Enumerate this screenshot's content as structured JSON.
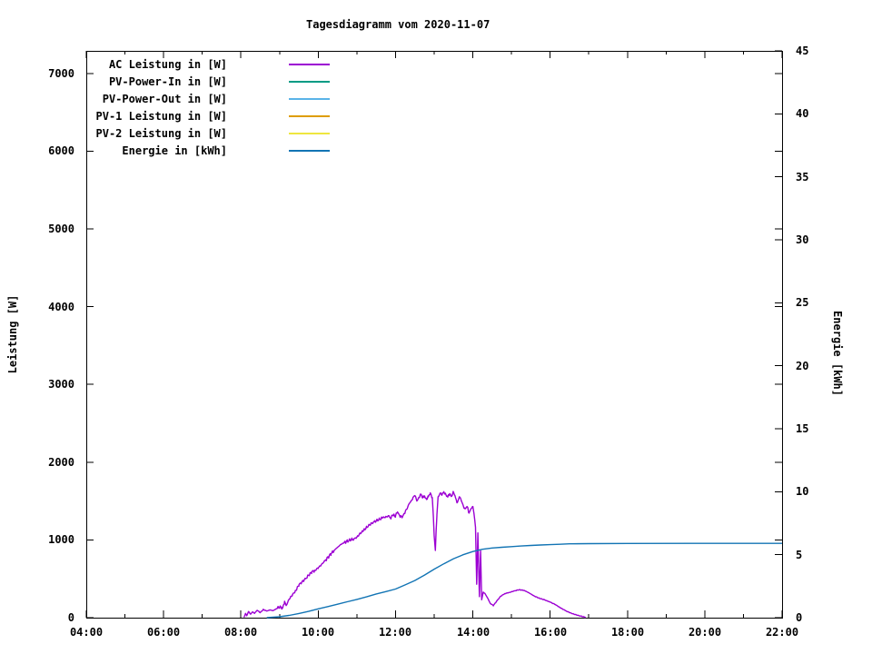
{
  "chart_data": {
    "type": "line",
    "title": "Tagesdiagramm vom 2020-11-07",
    "background": "#ffffff",
    "legend_position": "top-left-inside",
    "grid": false,
    "x_axis": {
      "label": "",
      "range_hours": [
        4,
        22
      ],
      "tick_hours": [
        4,
        6,
        8,
        10,
        12,
        14,
        16,
        18,
        20,
        22
      ],
      "tick_labels": [
        "04:00",
        "06:00",
        "08:00",
        "10:00",
        "12:00",
        "14:00",
        "16:00",
        "18:00",
        "20:00",
        "22:00"
      ],
      "minor_tick_hours": [
        5,
        7,
        9,
        11,
        13,
        15,
        17,
        19,
        21
      ]
    },
    "y_left": {
      "label": "Leistung [W]",
      "range": [
        0,
        7290
      ],
      "ticks": [
        0,
        1000,
        2000,
        3000,
        4000,
        5000,
        6000,
        7000
      ],
      "tick_labels": [
        "0",
        "1000",
        "2000",
        "3000",
        "4000",
        "5000",
        "6000",
        "7000"
      ]
    },
    "y_right": {
      "label": "Energie [kWh]",
      "range": [
        0,
        45
      ],
      "ticks": [
        0,
        5,
        10,
        15,
        20,
        25,
        30,
        35,
        40,
        45
      ],
      "tick_labels": [
        "0",
        "5",
        "10",
        "15",
        "20",
        "25",
        "30",
        "35",
        "40",
        "45"
      ]
    },
    "series": [
      {
        "name": "AC Leistung in [W]",
        "color": "#9C00D3",
        "axis": "left",
        "points": [
          [
            8.08,
            5
          ],
          [
            8.12,
            55
          ],
          [
            8.15,
            25
          ],
          [
            8.2,
            80
          ],
          [
            8.25,
            45
          ],
          [
            8.3,
            75
          ],
          [
            8.35,
            55
          ],
          [
            8.42,
            95
          ],
          [
            8.5,
            65
          ],
          [
            8.58,
            105
          ],
          [
            8.67,
            85
          ],
          [
            8.75,
            100
          ],
          [
            8.83,
            90
          ],
          [
            8.92,
            115
          ],
          [
            9.0,
            135
          ],
          [
            9.08,
            125
          ],
          [
            9.13,
            210
          ],
          [
            9.17,
            155
          ],
          [
            9.25,
            240
          ],
          [
            9.33,
            290
          ],
          [
            9.42,
            350
          ],
          [
            9.5,
            420
          ],
          [
            9.58,
            460
          ],
          [
            9.67,
            500
          ],
          [
            9.75,
            545
          ],
          [
            9.83,
            585
          ],
          [
            9.92,
            610
          ],
          [
            10.0,
            640
          ],
          [
            10.08,
            680
          ],
          [
            10.17,
            730
          ],
          [
            10.25,
            775
          ],
          [
            10.33,
            820
          ],
          [
            10.42,
            870
          ],
          [
            10.5,
            905
          ],
          [
            10.58,
            940
          ],
          [
            10.67,
            965
          ],
          [
            10.75,
            985
          ],
          [
            10.83,
            1000
          ],
          [
            10.92,
            1010
          ],
          [
            11.0,
            1035
          ],
          [
            11.08,
            1080
          ],
          [
            11.17,
            1120
          ],
          [
            11.25,
            1160
          ],
          [
            11.33,
            1195
          ],
          [
            11.42,
            1225
          ],
          [
            11.5,
            1245
          ],
          [
            11.58,
            1265
          ],
          [
            11.67,
            1285
          ],
          [
            11.75,
            1295
          ],
          [
            11.83,
            1310
          ],
          [
            11.88,
            1270
          ],
          [
            11.92,
            1320
          ],
          [
            12.0,
            1305
          ],
          [
            12.05,
            1360
          ],
          [
            12.1,
            1320
          ],
          [
            12.17,
            1285
          ],
          [
            12.22,
            1340
          ],
          [
            12.28,
            1395
          ],
          [
            12.33,
            1445
          ],
          [
            12.4,
            1500
          ],
          [
            12.45,
            1545
          ],
          [
            12.5,
            1570
          ],
          [
            12.55,
            1500
          ],
          [
            12.6,
            1545
          ],
          [
            12.65,
            1590
          ],
          [
            12.7,
            1540
          ],
          [
            12.75,
            1565
          ],
          [
            12.8,
            1520
          ],
          [
            12.85,
            1555
          ],
          [
            12.9,
            1605
          ],
          [
            12.95,
            1545
          ],
          [
            12.98,
            1300
          ],
          [
            13.0,
            1050
          ],
          [
            13.03,
            865
          ],
          [
            13.07,
            1320
          ],
          [
            13.1,
            1555
          ],
          [
            13.15,
            1600
          ],
          [
            13.2,
            1575
          ],
          [
            13.25,
            1620
          ],
          [
            13.3,
            1585
          ],
          [
            13.35,
            1550
          ],
          [
            13.4,
            1595
          ],
          [
            13.45,
            1560
          ],
          [
            13.5,
            1615
          ],
          [
            13.55,
            1545
          ],
          [
            13.6,
            1480
          ],
          [
            13.65,
            1555
          ],
          [
            13.7,
            1505
          ],
          [
            13.75,
            1445
          ],
          [
            13.8,
            1400
          ],
          [
            13.85,
            1430
          ],
          [
            13.9,
            1345
          ],
          [
            13.95,
            1400
          ],
          [
            14.0,
            1430
          ],
          [
            14.03,
            1340
          ],
          [
            14.07,
            1160
          ],
          [
            14.1,
            430
          ],
          [
            14.13,
            1090
          ],
          [
            14.17,
            270
          ],
          [
            14.2,
            860
          ],
          [
            14.23,
            230
          ],
          [
            14.27,
            330
          ],
          [
            14.32,
            305
          ],
          [
            14.38,
            255
          ],
          [
            14.45,
            185
          ],
          [
            14.53,
            155
          ],
          [
            14.62,
            215
          ],
          [
            14.72,
            275
          ],
          [
            14.83,
            310
          ],
          [
            14.95,
            325
          ],
          [
            15.08,
            345
          ],
          [
            15.2,
            360
          ],
          [
            15.33,
            350
          ],
          [
            15.45,
            320
          ],
          [
            15.58,
            280
          ],
          [
            15.72,
            250
          ],
          [
            15.85,
            230
          ],
          [
            16.0,
            200
          ],
          [
            16.13,
            170
          ],
          [
            16.27,
            125
          ],
          [
            16.42,
            85
          ],
          [
            16.58,
            50
          ],
          [
            16.75,
            25
          ],
          [
            16.92,
            5
          ]
        ]
      },
      {
        "name": "PV-Power-In in [W]",
        "color": "#009B84",
        "axis": "left",
        "points": []
      },
      {
        "name": "PV-Power-Out in [W]",
        "color": "#5AB3E8",
        "axis": "left",
        "points": []
      },
      {
        "name": "PV-1 Leistung in [W]",
        "color": "#DE9D00",
        "axis": "left",
        "points": []
      },
      {
        "name": "PV-2 Leistung in [W]",
        "color": "#EEE63F",
        "axis": "left",
        "points": []
      },
      {
        "name": "Energie in [kWh]",
        "color": "#1274B4",
        "axis": "right",
        "points": [
          [
            8.67,
            0
          ],
          [
            9.0,
            0.07
          ],
          [
            9.25,
            0.18
          ],
          [
            9.5,
            0.33
          ],
          [
            9.75,
            0.5
          ],
          [
            10.0,
            0.7
          ],
          [
            10.25,
            0.88
          ],
          [
            10.5,
            1.07
          ],
          [
            10.75,
            1.26
          ],
          [
            11.0,
            1.45
          ],
          [
            11.25,
            1.65
          ],
          [
            11.5,
            1.88
          ],
          [
            11.75,
            2.07
          ],
          [
            12.0,
            2.27
          ],
          [
            12.25,
            2.6
          ],
          [
            12.5,
            2.95
          ],
          [
            12.75,
            3.38
          ],
          [
            13.0,
            3.85
          ],
          [
            13.25,
            4.28
          ],
          [
            13.5,
            4.68
          ],
          [
            13.75,
            5.0
          ],
          [
            14.0,
            5.25
          ],
          [
            14.25,
            5.43
          ],
          [
            14.5,
            5.53
          ],
          [
            14.75,
            5.59
          ],
          [
            15.0,
            5.64
          ],
          [
            15.25,
            5.69
          ],
          [
            15.5,
            5.73
          ],
          [
            15.75,
            5.77
          ],
          [
            16.0,
            5.8
          ],
          [
            16.25,
            5.83
          ],
          [
            16.5,
            5.86
          ],
          [
            17.0,
            5.88
          ],
          [
            18.0,
            5.89
          ],
          [
            20.0,
            5.9
          ],
          [
            22.0,
            5.9
          ]
        ]
      }
    ]
  }
}
